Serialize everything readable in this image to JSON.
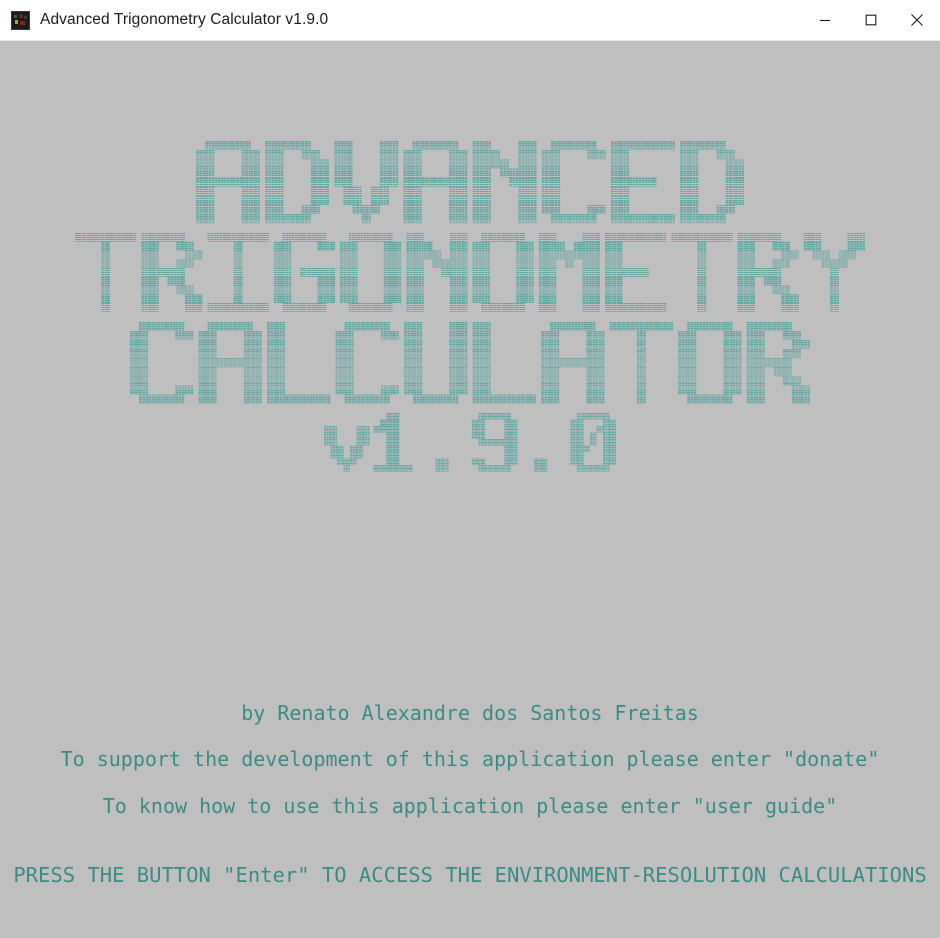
{
  "window": {
    "title": "Advanced Trigonometry Calculator v1.9.0",
    "icon": "app-icon",
    "controls": {
      "minimize": "minimize-icon",
      "maximize": "maximize-icon",
      "close": "close-icon"
    },
    "background_color": "#bfbfbf",
    "titlebar_color": "#ffffff"
  },
  "banner": {
    "accent_color": "#63a8a5",
    "lines": [
      "ADVANCED",
      "TRIGONOMETRY",
      "CALCULATOR",
      "v1.9.0"
    ],
    "rows": [
      [
        "A",
        "D",
        "V",
        "A",
        "N",
        "C",
        "E",
        "D"
      ],
      [
        "T",
        "R",
        "I",
        "G",
        "O",
        "N",
        "O",
        "M",
        "E",
        "T",
        "R",
        "Y"
      ],
      [
        "C",
        "A",
        "L",
        "C",
        "U",
        "L",
        "A",
        "T",
        "O",
        "R"
      ],
      [
        "v",
        "1",
        ".",
        "9",
        ".",
        "0"
      ]
    ]
  },
  "messages": {
    "text_color": "#3a8c85",
    "author": "by Renato Alexandre dos Santos Freitas",
    "donate": "To support the development of this application please enter \"donate\"",
    "guide": "To know how to use this application please enter \"user guide\"",
    "enter": "PRESS THE BUTTON \"Enter\" TO ACCESS THE ENVIRONMENT-RESOLUTION CALCULATIONS"
  }
}
